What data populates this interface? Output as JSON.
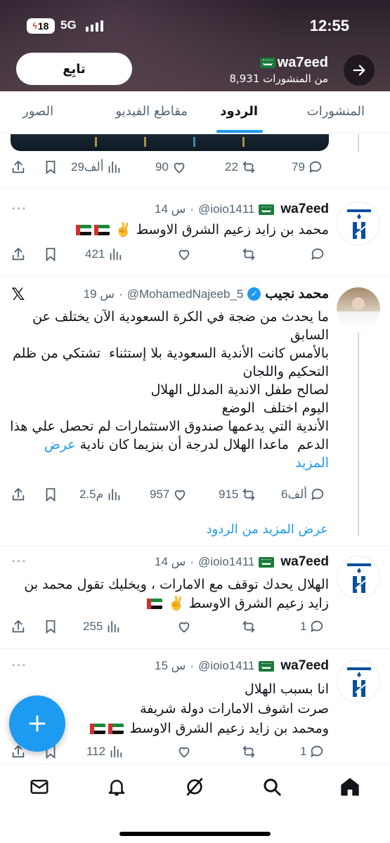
{
  "status_bar": {
    "time": "12:55",
    "battery": "18",
    "network": "5G"
  },
  "profile": {
    "name": "wa7eed",
    "posts_count": "8,931 من المنشورات",
    "follow_label": "تابِع"
  },
  "tabs": [
    {
      "label": "المنشورات",
      "active": false
    },
    {
      "label": "الردود",
      "active": true
    },
    {
      "label": "مقاطع الفيديو",
      "active": false
    },
    {
      "label": "الصور",
      "active": false
    }
  ],
  "first_actions": {
    "replies": "79",
    "reposts": "22",
    "likes": "90",
    "views": "29ألف"
  },
  "tweets": [
    {
      "name": "wa7eed",
      "handle": "@ioio1411",
      "time": "14 س",
      "text": "محمد بن زايد زعيم الشرق الاوسط ✌️",
      "replies": "",
      "reposts": "",
      "likes": "",
      "views": "421"
    },
    {
      "name": "محمد نجيب",
      "handle": "@MohamedNajeeb_5",
      "time": "19 س",
      "text": "ما يحدث من ضجة في الكرة السعودية الآن يختلف عن السابق\nبالأمس كانت الأندية السعودية بلا إستثناء  تشتكي من ظلم التحكيم واللجان\nلصالح طفل الاندية المدلل الهلال\nاليوم اختلف  الوضع\nالأندية التي يدعمها صندوق الاستثمارات لم تحصل علي هذا الدعم  ماعدا الهلال لدرجة أن بنزيما كان نادية ",
      "show_more": "عرض المزيد",
      "replies": "6ألف",
      "reposts": "915",
      "likes": "957",
      "views": "2.5م"
    },
    {
      "name": "wa7eed",
      "handle": "@ioio1411",
      "time": "14 س",
      "text": "الهلال يحدك توقف مع الامارات ، ويخليك تقول محمد بن زايد زعيم الشرق الاوسط ✌️",
      "replies": "1",
      "reposts": "",
      "likes": "",
      "views": "255"
    },
    {
      "name": "wa7eed",
      "handle": "@ioio1411",
      "time": "15 س",
      "text": "انا بسبب الهلال\nصرت اشوف الامارات دولة شريفة\nومحمد بن زايد زعيم الشرق الاوسط",
      "replies": "1",
      "reposts": "",
      "likes": "",
      "views": "112"
    }
  ],
  "show_more_replies": "عرض المزيد من الردود",
  "icons": {
    "back": "arrow-right-icon",
    "compose": "plus-icon",
    "nav": [
      "mail-icon",
      "bell-icon",
      "grok-icon",
      "search-icon",
      "home-icon"
    ]
  },
  "colors": {
    "accent": "#1d9bf0",
    "text": "#0f1419",
    "muted": "#536471"
  }
}
